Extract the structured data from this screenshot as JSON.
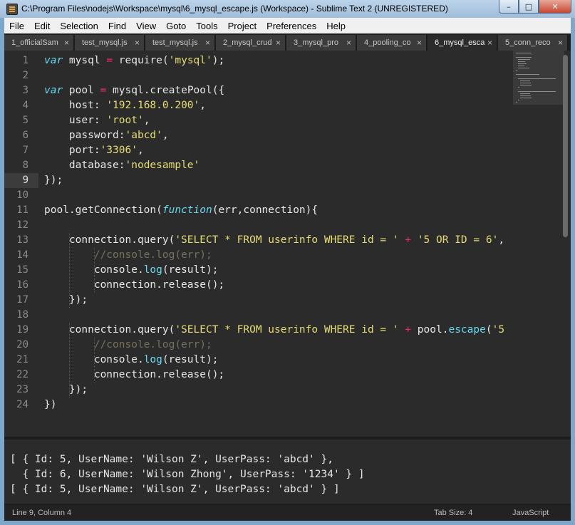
{
  "window": {
    "title": "C:\\Program Files\\nodejs\\Workspace\\mysql\\6_mysql_escape.js (Workspace) - Sublime Text 2 (UNREGISTERED)",
    "controls": [
      "minimize-icon",
      "maximize-icon",
      "close-icon"
    ]
  },
  "menu": [
    "File",
    "Edit",
    "Selection",
    "Find",
    "View",
    "Goto",
    "Tools",
    "Project",
    "Preferences",
    "Help"
  ],
  "tabs": [
    {
      "label": "1_officialSam",
      "close": "×",
      "active": false
    },
    {
      "label": "test_mysql.js",
      "close": "×",
      "active": false
    },
    {
      "label": "test_mysql.js",
      "close": "×",
      "active": false
    },
    {
      "label": "2_mysql_crud",
      "close": "×",
      "active": false
    },
    {
      "label": "3_mysql_pro",
      "close": "×",
      "active": false
    },
    {
      "label": "4_pooling_co",
      "close": "×",
      "active": false
    },
    {
      "label": "6_mysql_esca",
      "close": "×",
      "active": true
    },
    {
      "label": "5_conn_reco",
      "close": "×",
      "active": false
    }
  ],
  "editor": {
    "current_line": 9,
    "line_numbers": [
      "1",
      "2",
      "3",
      "4",
      "5",
      "6",
      "7",
      "8",
      "9",
      "10",
      "11",
      "12",
      "13",
      "14",
      "15",
      "16",
      "17",
      "18",
      "19",
      "20",
      "21",
      "22",
      "23",
      "24"
    ],
    "lines": [
      "var mysql = require('mysql');",
      "",
      "var pool = mysql.createPool({",
      "    host: '192.168.0.200',",
      "    user: 'root',",
      "    password:'abcd',",
      "    port:'3306',",
      "    database:'nodesample'",
      "});",
      "",
      "pool.getConnection(function(err,connection){",
      "",
      "    connection.query('SELECT * FROM userinfo WHERE id = ' + '5 OR ID = 6',",
      "        //console.log(err);",
      "        console.log(result);",
      "        connection.release();",
      "    });",
      "",
      "    connection.query('SELECT * FROM userinfo WHERE id = ' + pool.escape('5",
      "        //console.log(err);",
      "        console.log(result);",
      "        connection.release();",
      "    });",
      "})"
    ]
  },
  "console": {
    "lines": [
      "[ { Id: 5, UserName: 'Wilson Z', UserPass: 'abcd' },",
      "  { Id: 6, UserName: 'Wilson Zhong', UserPass: '1234' } ]",
      "[ { Id: 5, UserName: 'Wilson Z', UserPass: 'abcd' } ]"
    ]
  },
  "status": {
    "position": "Line 9, Column 4",
    "tab_size": "Tab Size: 4",
    "syntax": "JavaScript"
  }
}
